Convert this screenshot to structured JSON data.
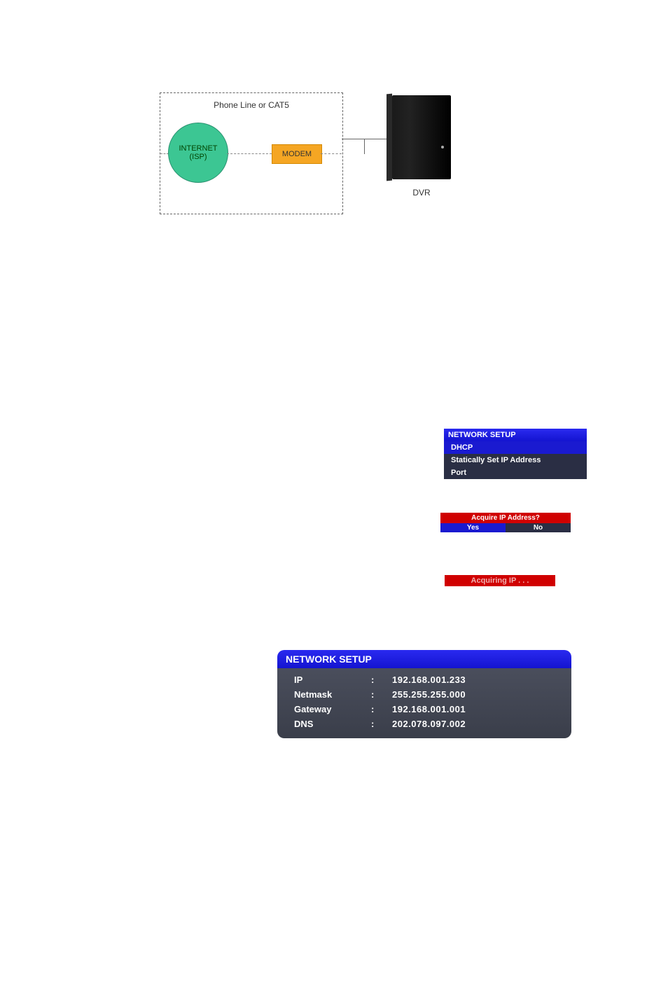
{
  "diagram": {
    "box_label": "Phone Line or CAT5",
    "internet": "INTERNET\n(ISP)",
    "modem": "MODEM",
    "dvr_label": "DVR"
  },
  "network_menu": {
    "title": "NETWORK SETUP",
    "items": [
      {
        "label": "DHCP",
        "highlight": true
      },
      {
        "label": "Statically Set IP Address",
        "highlight": false
      },
      {
        "label": "Port",
        "highlight": false
      }
    ]
  },
  "acquire_prompt": {
    "title": "Acquire IP Address?",
    "yes": "Yes",
    "no": "No"
  },
  "acquiring_badge": "Acquiring IP . . .",
  "network_panel": {
    "title": "NETWORK SETUP",
    "rows": [
      {
        "label": "IP",
        "value": "192.168.001.233"
      },
      {
        "label": "Netmask",
        "value": "255.255.255.000"
      },
      {
        "label": "Gateway",
        "value": "192.168.001.001"
      },
      {
        "label": "DNS",
        "value": "202.078.097.002"
      }
    ]
  }
}
